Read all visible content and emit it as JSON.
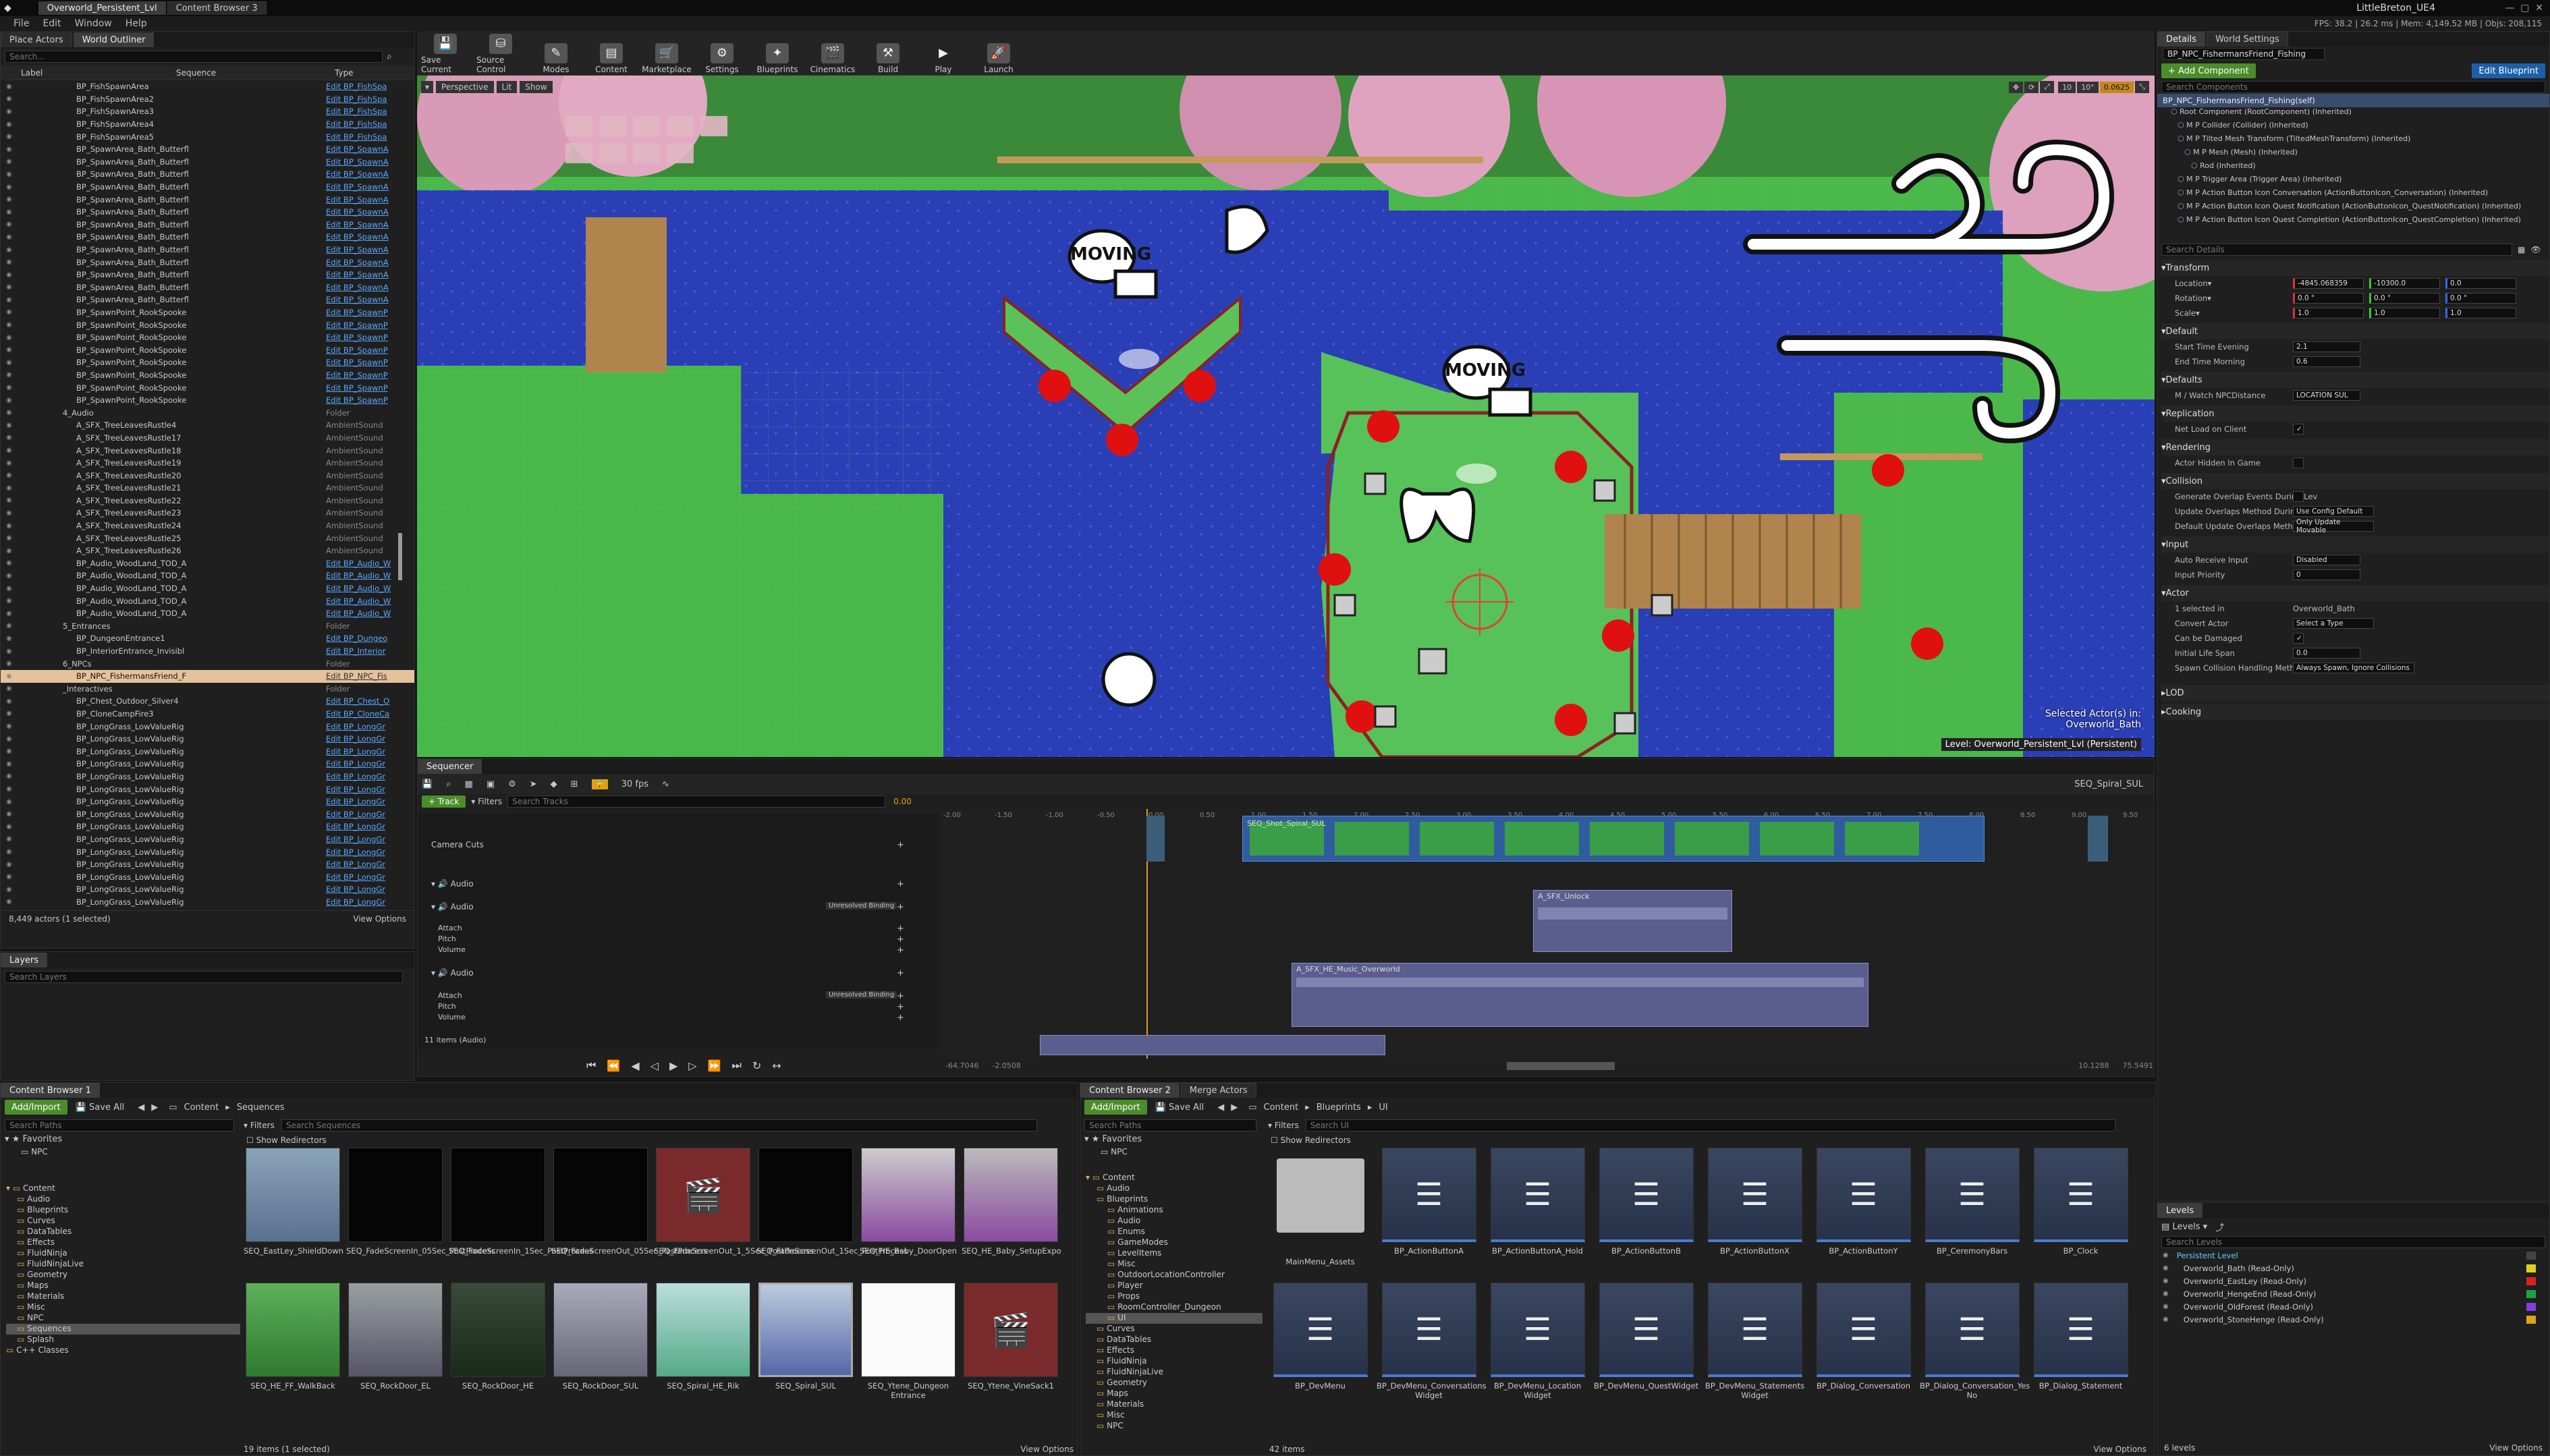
{
  "window": {
    "title_tabs": [
      "Overworld_Persistent_Lvl",
      "Content Browser 3"
    ],
    "app_name": "LittleBreton_UE4",
    "stats": "FPS: 38.2 | 26.2 ms | Mem: 4,149.52 MB | Objs: 208,115"
  },
  "menu": [
    "File",
    "Edit",
    "Window",
    "Help"
  ],
  "left_tabs": [
    "Place Actors",
    "World Outliner"
  ],
  "outliner": {
    "search_placeholder": "Search...",
    "col_label": "Label",
    "col_sequence": "Sequence",
    "col_type": "Type",
    "rows": [
      {
        "label": "BP_FishSpawnArea",
        "type": "Edit BP_FishSpa"
      },
      {
        "label": "BP_FishSpawnArea2",
        "type": "Edit BP_FishSpa"
      },
      {
        "label": "BP_FishSpawnArea3",
        "type": "Edit BP_FishSpa"
      },
      {
        "label": "BP_FishSpawnArea4",
        "type": "Edit BP_FishSpa"
      },
      {
        "label": "BP_FishSpawnArea5",
        "type": "Edit BP_FishSpa"
      },
      {
        "label": "BP_SpawnArea_Bath_Butterfl",
        "type": "Edit BP_SpawnA"
      },
      {
        "label": "BP_SpawnArea_Bath_Butterfl",
        "type": "Edit BP_SpawnA"
      },
      {
        "label": "BP_SpawnArea_Bath_Butterfl",
        "type": "Edit BP_SpawnA"
      },
      {
        "label": "BP_SpawnArea_Bath_Butterfl",
        "type": "Edit BP_SpawnA"
      },
      {
        "label": "BP_SpawnArea_Bath_Butterfl",
        "type": "Edit BP_SpawnA"
      },
      {
        "label": "BP_SpawnArea_Bath_Butterfl",
        "type": "Edit BP_SpawnA"
      },
      {
        "label": "BP_SpawnArea_Bath_Butterfl",
        "type": "Edit BP_SpawnA"
      },
      {
        "label": "BP_SpawnArea_Bath_Butterfl",
        "type": "Edit BP_SpawnA"
      },
      {
        "label": "BP_SpawnArea_Bath_Butterfl",
        "type": "Edit BP_SpawnA"
      },
      {
        "label": "BP_SpawnArea_Bath_Butterfl",
        "type": "Edit BP_SpawnA"
      },
      {
        "label": "BP_SpawnArea_Bath_Butterfl",
        "type": "Edit BP_SpawnA"
      },
      {
        "label": "BP_SpawnArea_Bath_Butterfl",
        "type": "Edit BP_SpawnA"
      },
      {
        "label": "BP_SpawnArea_Bath_Butterfl",
        "type": "Edit BP_SpawnA"
      },
      {
        "label": "BP_SpawnPoint_RookSpooke",
        "type": "Edit BP_SpawnP"
      },
      {
        "label": "BP_SpawnPoint_RookSpooke",
        "type": "Edit BP_SpawnP"
      },
      {
        "label": "BP_SpawnPoint_RookSpooke",
        "type": "Edit BP_SpawnP"
      },
      {
        "label": "BP_SpawnPoint_RookSpooke",
        "type": "Edit BP_SpawnP"
      },
      {
        "label": "BP_SpawnPoint_RookSpooke",
        "type": "Edit BP_SpawnP"
      },
      {
        "label": "BP_SpawnPoint_RookSpooke",
        "type": "Edit BP_SpawnP"
      },
      {
        "label": "BP_SpawnPoint_RookSpooke",
        "type": "Edit BP_SpawnP"
      },
      {
        "label": "BP_SpawnPoint_RookSpooke",
        "type": "Edit BP_SpawnP"
      },
      {
        "label": "4_Audio",
        "type": "Folder",
        "folder": true
      },
      {
        "label": "A_SFX_TreeLeavesRustle4",
        "type": "AmbientSound",
        "plain": true
      },
      {
        "label": "A_SFX_TreeLeavesRustle17",
        "type": "AmbientSound",
        "plain": true
      },
      {
        "label": "A_SFX_TreeLeavesRustle18",
        "type": "AmbientSound",
        "plain": true
      },
      {
        "label": "A_SFX_TreeLeavesRustle19",
        "type": "AmbientSound",
        "plain": true
      },
      {
        "label": "A_SFX_TreeLeavesRustle20",
        "type": "AmbientSound",
        "plain": true
      },
      {
        "label": "A_SFX_TreeLeavesRustle21",
        "type": "AmbientSound",
        "plain": true
      },
      {
        "label": "A_SFX_TreeLeavesRustle22",
        "type": "AmbientSound",
        "plain": true
      },
      {
        "label": "A_SFX_TreeLeavesRustle23",
        "type": "AmbientSound",
        "plain": true
      },
      {
        "label": "A_SFX_TreeLeavesRustle24",
        "type": "AmbientSound",
        "plain": true
      },
      {
        "label": "A_SFX_TreeLeavesRustle25",
        "type": "AmbientSound",
        "plain": true
      },
      {
        "label": "A_SFX_TreeLeavesRustle26",
        "type": "AmbientSound",
        "plain": true
      },
      {
        "label": "BP_Audio_WoodLand_TOD_A",
        "type": "Edit BP_Audio_W"
      },
      {
        "label": "BP_Audio_WoodLand_TOD_A",
        "type": "Edit BP_Audio_W"
      },
      {
        "label": "BP_Audio_WoodLand_TOD_A",
        "type": "Edit BP_Audio_W"
      },
      {
        "label": "BP_Audio_WoodLand_TOD_A",
        "type": "Edit BP_Audio_W"
      },
      {
        "label": "BP_Audio_WoodLand_TOD_A",
        "type": "Edit BP_Audio_W"
      },
      {
        "label": "5_Entrances",
        "type": "Folder",
        "folder": true
      },
      {
        "label": "BP_DungeonEntrance1",
        "type": "Edit BP_Dungeo"
      },
      {
        "label": "BP_InteriorEntrance_Invisibl",
        "type": "Edit BP_Interior"
      },
      {
        "label": "6_NPCs",
        "type": "Folder",
        "folder": true
      },
      {
        "label": "BP_NPC_FishermansFriend_F",
        "type": "Edit BP_NPC_Fis",
        "selected": true
      },
      {
        "label": "_Interactives",
        "type": "Folder",
        "folder": true
      },
      {
        "label": "BP_Chest_Outdoor_Silver4",
        "type": "Edit BP_Chest_O"
      },
      {
        "label": "BP_CloneCampFire3",
        "type": "Edit BP_CloneCa"
      },
      {
        "label": "BP_LongGrass_LowValueRig",
        "type": "Edit BP_LongGr"
      },
      {
        "label": "BP_LongGrass_LowValueRig",
        "type": "Edit BP_LongGr"
      },
      {
        "label": "BP_LongGrass_LowValueRig",
        "type": "Edit BP_LongGr"
      },
      {
        "label": "BP_LongGrass_LowValueRig",
        "type": "Edit BP_LongGr"
      },
      {
        "label": "BP_LongGrass_LowValueRig",
        "type": "Edit BP_LongGr"
      },
      {
        "label": "BP_LongGrass_LowValueRig",
        "type": "Edit BP_LongGr"
      },
      {
        "label": "BP_LongGrass_LowValueRig",
        "type": "Edit BP_LongGr"
      },
      {
        "label": "BP_LongGrass_LowValueRig",
        "type": "Edit BP_LongGr"
      },
      {
        "label": "BP_LongGrass_LowValueRig",
        "type": "Edit BP_LongGr"
      },
      {
        "label": "BP_LongGrass_LowValueRig",
        "type": "Edit BP_LongGr"
      },
      {
        "label": "BP_LongGrass_LowValueRig",
        "type": "Edit BP_LongGr"
      },
      {
        "label": "BP_LongGrass_LowValueRig",
        "type": "Edit BP_LongGr"
      },
      {
        "label": "BP_LongGrass_LowValueRig",
        "type": "Edit BP_LongGr"
      },
      {
        "label": "BP_LongGrass_LowValueRig",
        "type": "Edit BP_LongGr"
      },
      {
        "label": "BP_LongGrass_LowValueRig",
        "type": "Edit BP_LongGr"
      },
      {
        "label": "BP_LongGrass_LowValueRig",
        "type": "Edit BP_LongGr"
      }
    ],
    "footer": "8,449 actors (1 selected)",
    "view_options": "View Options"
  },
  "layers": {
    "tab": "Layers",
    "search_placeholder": "Search Layers"
  },
  "toolbar": [
    "Save Current",
    "Source Control",
    "Modes",
    "Content",
    "Marketplace",
    "Settings",
    "Blueprints",
    "Cinematics",
    "Build",
    "Play",
    "Launch"
  ],
  "viewport": {
    "perspective": "Perspective",
    "lit": "Lit",
    "show": "Show",
    "bubble1": "MOVING",
    "bubble2": "MOVING",
    "selected_actor": "Selected Actor(s) in:",
    "selected_level": "Overworld_Bath",
    "level_label": "Level: Overworld_Persistent_Lvl (Persistent)",
    "snap_values": [
      "10",
      "10°",
      "0.0625"
    ]
  },
  "sequencer": {
    "tab": "Sequencer",
    "track_btn": "Track",
    "filters": "Filters",
    "search_placeholder": "Search Tracks",
    "fps": "30 fps",
    "current_time": "0.00",
    "sequence_name": "SEQ_Spiral_SUL",
    "tracks": [
      "Camera Cuts",
      "Audio",
      "Audio",
      "Attach",
      "Pitch",
      "Volume",
      "Audio",
      "Attach",
      "Pitch",
      "Volume"
    ],
    "binding": "Unresolved Binding",
    "items_count": "11 items (Audio)",
    "shot_label": "SEQ_Shot_Spiral_SUL",
    "audio_clip1": "A_SFX_Unlock",
    "audio_clip2": "A_SFX_HE_Music_Overworld",
    "range_start": "-64.7046",
    "range_end": "-2.0508",
    "range_right": "10.1288",
    "range_far": "75.5491",
    "ticks": [
      "-2.00",
      "-1.50",
      "-1.00",
      "-0.50",
      "0.00",
      "0.50",
      "1.00",
      "1.50",
      "2.00",
      "2.50",
      "3.00",
      "3.50",
      "4.00",
      "4.50",
      "5.00",
      "5.50",
      "6.00",
      "6.50",
      "7.00",
      "7.50",
      "8.00",
      "8.50",
      "9.00",
      "9.50"
    ]
  },
  "details": {
    "tabs": [
      "Details",
      "World Settings"
    ],
    "actor_name": "BP_NPC_FishermansFriend_Fishing",
    "add_component": "+ Add Component",
    "edit_blueprint": "Edit Blueprint",
    "search_components": "Search Components",
    "self": "BP_NPC_FishermansFriend_Fishing(self)",
    "components": [
      "Root Component (RootComponent) (Inherited)",
      "M P Collider (Collider) (Inherited)",
      "M P Tilted Mesh Transform (TiltedMeshTransform) (Inherited)",
      "M P Mesh (Mesh) (Inherited)",
      "Rod (Inherited)",
      "M P Trigger Area (Trigger Area) (Inherited)",
      "M P Action Button Icon Conversation (ActionButtonIcon_Conversation) (Inherited)",
      "M P Action Button Icon Quest Notification (ActionButtonIcon_QuestNotification) (Inherited)",
      "M P Action Button Icon Quest Completion (ActionButtonIcon_QuestCompletion) (Inherited)"
    ],
    "search_details": "Search Details",
    "transform": "Transform",
    "location": "Location",
    "rotation": "Rotation",
    "scale": "Scale",
    "loc_vals": [
      "-4845.068359",
      "-10300.0",
      "0.0"
    ],
    "rot_vals": [
      "0.0 °",
      "0.0 °",
      "0.0 °"
    ],
    "scale_vals": [
      "1.0",
      "1.0",
      "1.0"
    ],
    "default": "Default",
    "start_time_evening": "Start Time Evening",
    "start_time_evening_val": "2.1",
    "end_time_morning": "End Time Morning",
    "end_time_morning_val": "0.6",
    "defaults": "Defaults",
    "npc_class": "M / Watch NPCDistance",
    "npc_class_val": "LOCATION SUL",
    "replication": "Replication",
    "net_load": "Net Load on Client",
    "rendering": "Rendering",
    "hidden_in_game": "Actor Hidden In Game",
    "collision": "Collision",
    "gen_overlap": "Generate Overlap Events During Lev",
    "update_overlap": "Update Overlaps Method During Lev",
    "update_overlap_val": "Use Config Default",
    "default_update": "Default Update Overlaps Method Dur",
    "default_update_val": "Only Update Movable",
    "input": "Input",
    "auto_receive": "Auto Receive Input",
    "auto_receive_val": "Disabled",
    "input_priority": "Input Priority",
    "input_priority_val": "0",
    "actor": "Actor",
    "one_selected": "1 selected in",
    "one_selected_val": "Overworld_Bath",
    "convert_actor": "Convert Actor",
    "convert_actor_val": "Select a Type",
    "can_be_damaged": "Can be Damaged",
    "initial_life": "Initial Life Span",
    "initial_life_val": "0.0",
    "spawn_collision": "Spawn Collision Handling Method",
    "spawn_collision_val": "Always Spawn, Ignore Collisions",
    "lod": "LOD",
    "cooking": "Cooking"
  },
  "levels": {
    "tab": "Levels",
    "levels_btn": "Levels",
    "search_placeholder": "Search Levels",
    "items": [
      "Persistent Level",
      "Overworld_Bath (Read-Only)",
      "Overworld_EastLey (Read-Only)",
      "Overworld_HengeEnd (Read-Only)",
      "Overworld_OldForest (Read-Only)",
      "Overworld_StoneHenge (Read-Only)"
    ],
    "footer": "6 levels",
    "view_options": "View Options"
  },
  "cb1": {
    "tab": "Content Browser 1",
    "add_import": "Add/Import",
    "save_all": "Save All",
    "path": [
      "Content",
      "Sequences"
    ],
    "search_paths": "Search Paths",
    "favorites": "Favorites",
    "fav_items": [
      "NPC"
    ],
    "filters": "Filters",
    "search_assets": "Search Sequences",
    "show_redirectors": "Show Redirectors",
    "tree": [
      "Content",
      "Audio",
      "Blueprints",
      "Curves",
      "DataTables",
      "Effects",
      "FluidNinja",
      "FluidNinjaLive",
      "Geometry",
      "Maps",
      "Materials",
      "Misc",
      "NPC",
      "Sequences",
      "Splash",
      "C++ Classes"
    ],
    "assets": [
      "SEQ_EastLey_ShieldDown",
      "SEQ_FadeScreenIn_05Sec_PostProcess",
      "SEQ_FadeScreenIn_1Sec_PostProcess",
      "SEQ_FadeScreenOut_05Sec_PostProcess",
      "SEQ_FadeScreenOut_1_5Sec_PostProcess",
      "SEQ_FadeScreenOut_1Sec_PostProcess",
      "SEQ_HE_Baby_DoorOpen",
      "SEQ_HE_Baby_SetupExpo",
      "SEQ_HE_FF_WalkBack",
      "SEQ_RockDoor_EL",
      "SEQ_RockDoor_HE",
      "SEQ_RockDoor_SUL",
      "SEQ_Spiral_HE_Rik",
      "SEQ_Spiral_SUL",
      "SEQ_Ytene_Dungeon Entrance",
      "SEQ_Ytene_VineSack1"
    ],
    "footer": "19 items (1 selected)",
    "view_options": "View Options"
  },
  "cb2": {
    "tabs": [
      "Content Browser 2",
      "Merge Actors"
    ],
    "add_import": "Add/Import",
    "save_all": "Save All",
    "path": [
      "Content",
      "Blueprints",
      "UI"
    ],
    "search_paths": "Search Paths",
    "favorites": "Favorites",
    "fav_items": [
      "NPC"
    ],
    "filters": "Filters",
    "search_assets": "Search UI",
    "show_redirectors": "Show Redirectors",
    "tree": [
      "Content",
      "Audio",
      "Blueprints",
      "Animations",
      "Audio",
      "Enums",
      "GameModes",
      "LevelItems",
      "Misc",
      "OutdoorLocationController",
      "Player",
      "Props",
      "RoomController_Dungeon",
      "UI",
      "Curves",
      "DataTables",
      "Effects",
      "FluidNinja",
      "FluidNinjaLive",
      "Geometry",
      "Maps",
      "Materials",
      "Misc",
      "NPC"
    ],
    "assets": [
      "MainMenu_Assets",
      "BP_ActionButtonA",
      "BP_ActionButtonA_Hold",
      "BP_ActionButtonB",
      "BP_ActionButtonX",
      "BP_ActionButtonY",
      "BP_CeremonyBars",
      "BP_Clock",
      "BP_DevMenu",
      "BP_DevMenu_Conversations Widget",
      "BP_DevMenu_Location Widget",
      "BP_DevMenu_QuestWidget",
      "BP_DevMenu_Statements Widget",
      "BP_Dialog_Conversation",
      "BP_Dialog_Conversation_Yes No",
      "BP_Dialog_Statement"
    ],
    "footer": "42 items",
    "view_options": "View Options"
  }
}
